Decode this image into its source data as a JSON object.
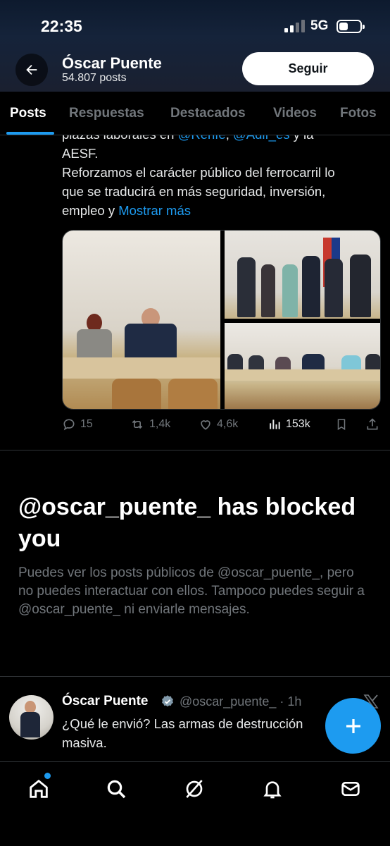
{
  "status_bar": {
    "time": "22:35",
    "network": "5G",
    "battery_fraction": 0.35
  },
  "header": {
    "name": "Óscar Puente",
    "post_count": "54.807 posts",
    "follow_label": "Seguir",
    "back_icon": "arrow-left-icon"
  },
  "tabs": [
    {
      "label": "Posts",
      "active": true
    },
    {
      "label": "Respuestas",
      "active": false
    },
    {
      "label": "Destacados",
      "active": false
    },
    {
      "label": "Videos",
      "active": false
    },
    {
      "label": "Fotos",
      "active": false
    }
  ],
  "tweet1": {
    "line0_pre": "plazas laborales en ",
    "mention1": "@Renfe",
    "line0_mid": ", ",
    "mention2": "@Adif_es",
    "line0_post": " y la",
    "line1": "AESF.",
    "line2": "Reforzamos el carácter público del ferrocarril lo",
    "line3": "que se traducirá en más seguridad, inversión,",
    "line4_pre": "empleo y ",
    "show_more": "Mostrar más",
    "replies": "15",
    "reposts": "1,4k",
    "likes": "4,6k",
    "views": "153k"
  },
  "blocked": {
    "title": "@oscar_puente_ has blocked you",
    "description": "Puedes ver los posts públicos de @oscar_puente_, pero no puedes interactuar con ellos. Tampoco puedes seguir a @oscar_puente_ ni enviarle mensajes."
  },
  "tweet2": {
    "name": "Óscar Puente",
    "handle_time": "@oscar_puente_ · 1h",
    "line1": "¿Qué le envió? Las armas de destrucción",
    "line2": "masiva."
  },
  "colors": {
    "accent": "#1d9bf0",
    "muted": "#71767b",
    "text": "#e7e9ea"
  }
}
